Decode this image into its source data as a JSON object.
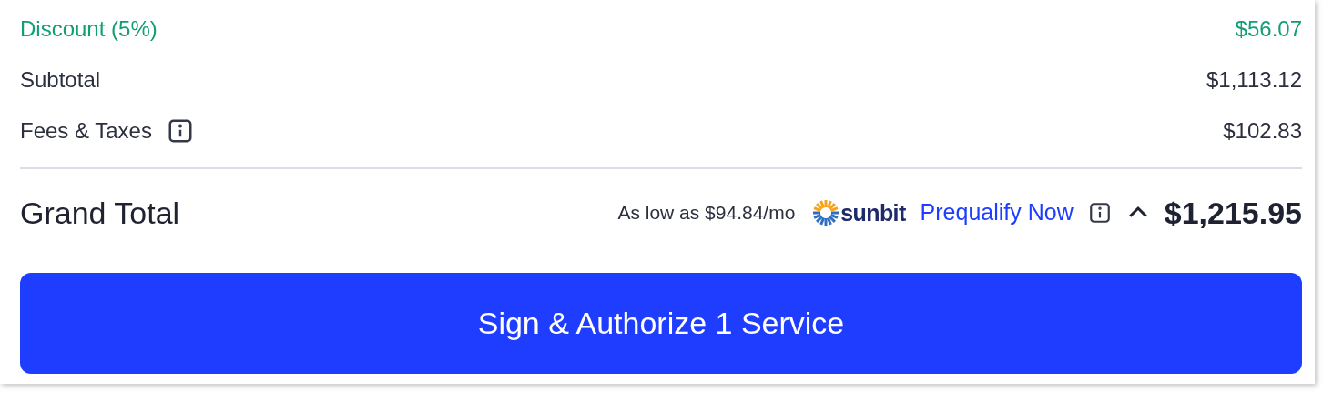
{
  "summary_rows": [
    {
      "kind": "discount",
      "label": "Discount (5%)",
      "value": "$56.07",
      "info": false
    },
    {
      "kind": "normal",
      "label": "Subtotal",
      "value": "$1,113.12",
      "info": false
    },
    {
      "kind": "normal",
      "label": "Fees & Taxes",
      "value": "$102.83",
      "info": true
    }
  ],
  "grand_total": {
    "label": "Grand Total",
    "financing": "As low as $94.84/mo",
    "logo_text": "sunbit",
    "link": "Prequalify Now",
    "expanded": true,
    "amount": "$1,215.95"
  },
  "primary_button": "Sign & Authorize 1 Service"
}
